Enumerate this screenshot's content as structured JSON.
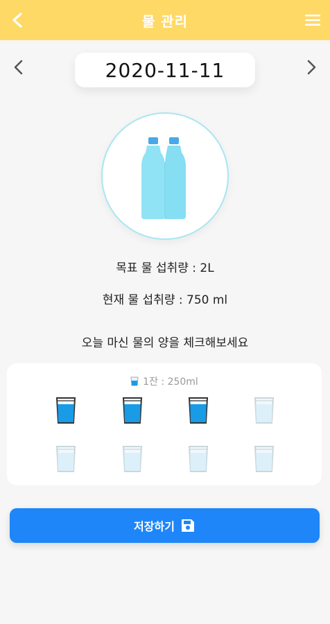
{
  "header": {
    "title": "물 관리"
  },
  "date": {
    "value": "2020-11-11"
  },
  "water": {
    "goal_text": "목표 물 섭취량 : 2L",
    "current_text": "현재 물 섭취량 : 750 ml",
    "prompt_text": "오늘 마신 물의 양을 체크해보세요",
    "cup_size_text": "1잔 : 250ml",
    "cups_filled": 3,
    "cups_total": 8
  },
  "actions": {
    "save_label": "저장하기"
  },
  "colors": {
    "header": "#ffd966",
    "accent": "#1e86f8",
    "bottle": "#8fe3f5",
    "cup_filled": "#1a9be6",
    "cup_empty": "#dcf0fa"
  }
}
